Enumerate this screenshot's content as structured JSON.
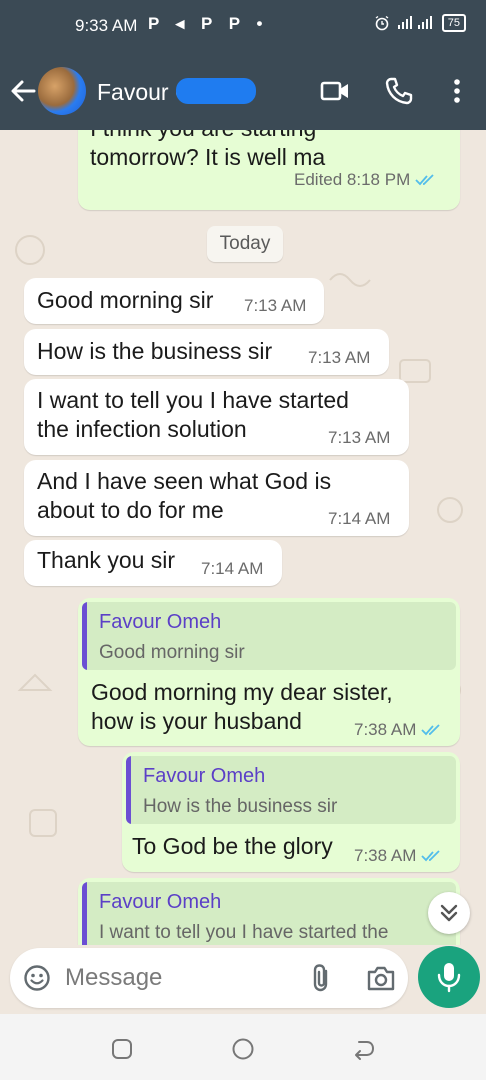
{
  "status_bar": {
    "time": "9:33 AM",
    "app_icons": "P ◂ P P •",
    "battery": "75"
  },
  "header": {
    "contact_name": "Favour Omeh",
    "icons": [
      "back-arrow-icon",
      "video-call-icon",
      "phone-icon",
      "more-vertical-icon"
    ]
  },
  "chat": {
    "top_partial": {
      "text": "I think you are starting\ntomorrow? It is well ma",
      "time": "Edited 8:18 PM"
    },
    "date_chip": "Today",
    "incoming": [
      {
        "text": "Good morning sir",
        "time": "7:13 AM"
      },
      {
        "text": "How is the business sir",
        "time": "7:13 AM"
      },
      {
        "text": "I want to tell you I have started\nthe infection solution",
        "time": "7:13 AM"
      },
      {
        "text": "And I have seen what God is\nabout to do for me",
        "time": "7:14 AM"
      },
      {
        "text": "Thank you sir",
        "time": "7:14 AM"
      }
    ],
    "replies": [
      {
        "quote_name": "Favour Omeh",
        "quote_text": "Good morning sir",
        "text": "Good morning my dear sister,\nhow is your husband",
        "time": "7:38 AM"
      },
      {
        "quote_name": "Favour Omeh",
        "quote_text": "How is the business sir",
        "text": "To God be the glory",
        "time": "7:38 AM"
      },
      {
        "quote_name": "Favour Omeh",
        "quote_text": "I want to tell you I have started the"
      }
    ]
  },
  "input": {
    "placeholder": "Message",
    "icons": [
      "emoji-icon",
      "attach-icon",
      "camera-icon",
      "mic-icon"
    ]
  },
  "colors": {
    "header_bg": "#3b4a55",
    "chat_bg": "#efe7de",
    "outgoing_bubble": "#e6fdd4",
    "incoming_bubble": "#ffffff",
    "accent_green": "#1aa37e",
    "read_tick": "#53bdeb",
    "quote_accent": "#6b4fd3"
  }
}
